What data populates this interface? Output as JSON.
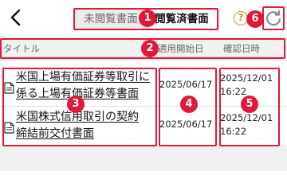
{
  "nav": {
    "back_icon": "chevron-left-icon"
  },
  "tabs": [
    {
      "label": "未閲覧書面",
      "selected": false
    },
    {
      "label": "閲覧済書面",
      "selected": true
    }
  ],
  "help": {
    "glyph": "?",
    "icon": "help-circle-icon",
    "color": "#c69a1e"
  },
  "refresh": {
    "icon": "refresh-icon"
  },
  "table": {
    "columns": [
      "タイトル",
      "適用開始日",
      "確認日時"
    ],
    "rows": [
      {
        "title_lines": [
          "米国上場有価証券等取引に",
          "係る上場有価証券等書面"
        ],
        "start_date": "2025/06/17",
        "confirm_date": "2025/12/01",
        "confirm_time": "16:22"
      },
      {
        "title_lines": [
          "米国株式信用取引の契約",
          "締結前交付書面"
        ],
        "start_date": "2025/06/17",
        "confirm_date": "2025/12/01",
        "confirm_time": "16:22"
      }
    ]
  },
  "annotations": {
    "color": "#e0193a",
    "labels": [
      "1",
      "2",
      "3",
      "4",
      "5",
      "6"
    ]
  }
}
